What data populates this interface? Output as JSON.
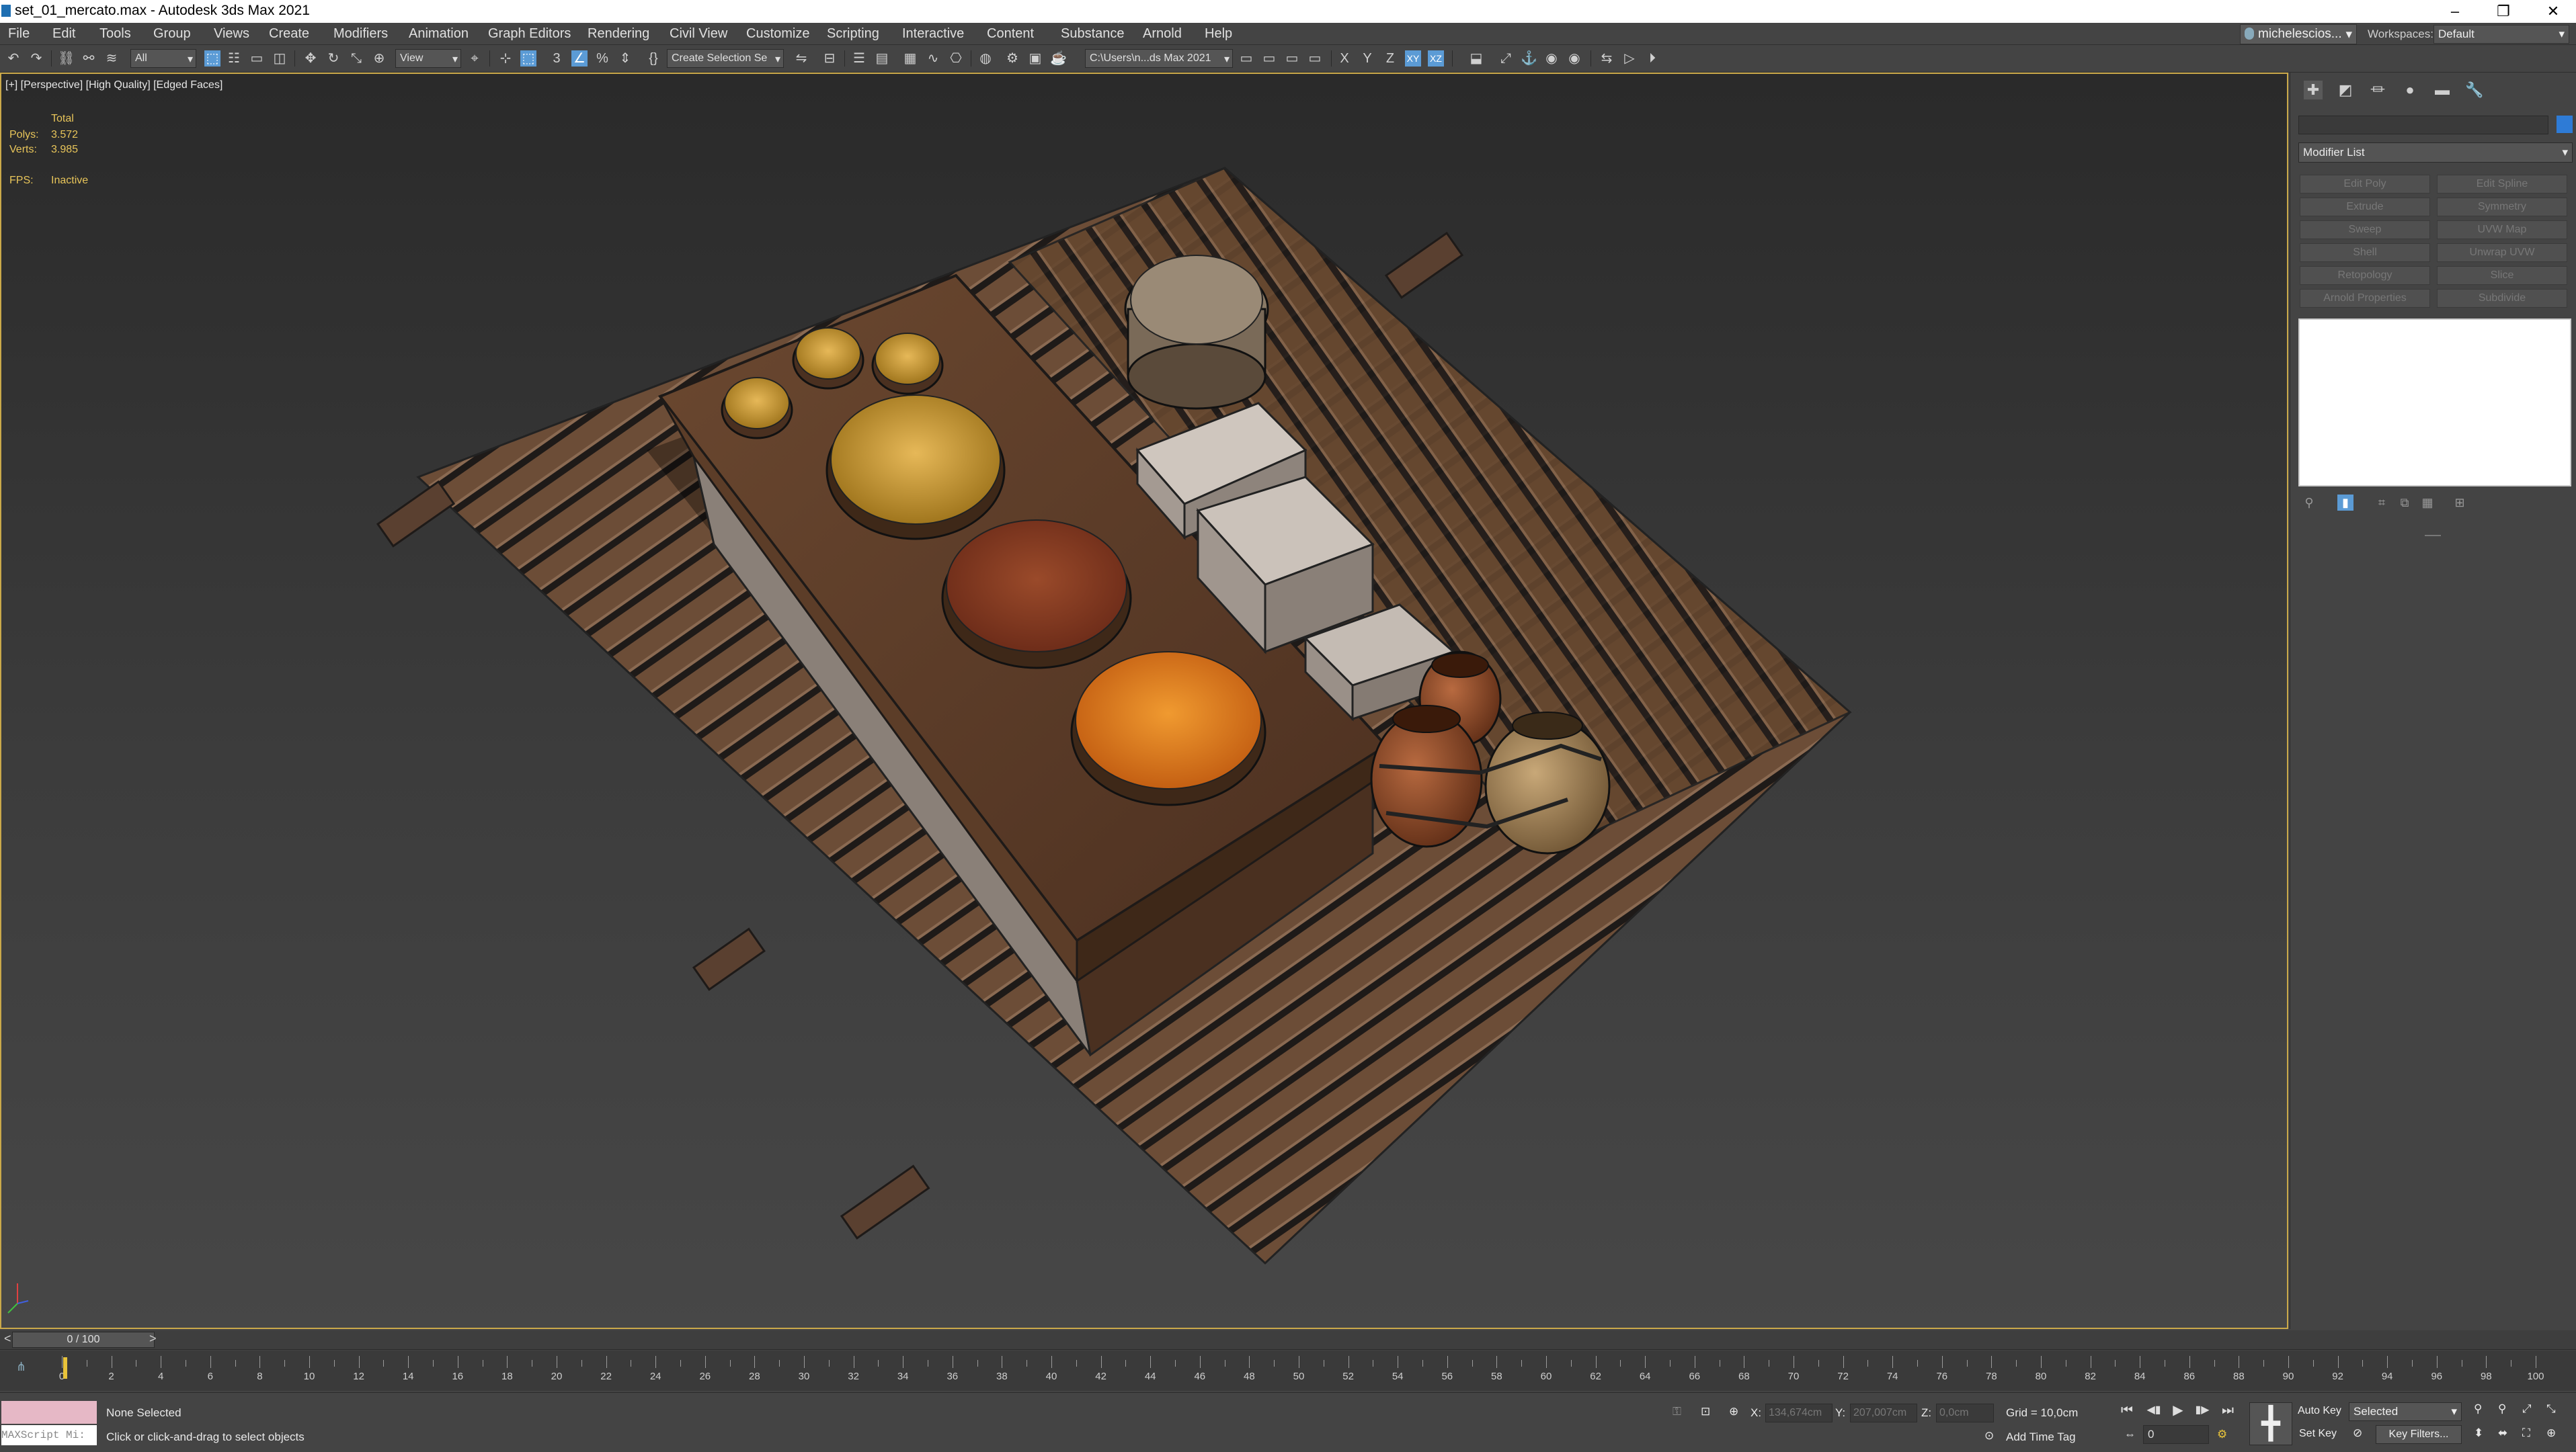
{
  "window": {
    "title": "set_01_mercato.max - Autodesk 3ds Max 2021",
    "minimize_glyph": "–",
    "restore_glyph": "❐",
    "close_glyph": "✕"
  },
  "menu": [
    "File",
    "Edit",
    "Tools",
    "Group",
    "Views",
    "Create",
    "Modifiers",
    "Animation",
    "Graph Editors",
    "Rendering",
    "Civil View",
    "Customize",
    "Scripting",
    "Interactive",
    "Content",
    "Substance",
    "Arnold",
    "Help"
  ],
  "user": {
    "name": "michelescios...",
    "arrow": "▾"
  },
  "workspace": {
    "label": "Workspaces:",
    "value": "Default",
    "arrow": "▾"
  },
  "toolbar": {
    "filter_value": "All",
    "refcoord_value": "View",
    "selection_set_placeholder": "Create Selection Se",
    "project_path": "C:\\Users\\n...ds Max 2021",
    "arrow": "▾",
    "axis_x": "X",
    "axis_y": "Y",
    "axis_z": "Z",
    "axis_xy": "XY",
    "axis_xz": "XZ",
    "icons": {
      "undo": "↶",
      "redo": "↷",
      "link": "⛓",
      "unlink": "⚯",
      "bind": "≋",
      "select": "⬚",
      "select_name": "☷",
      "region": "▭",
      "window": "◫",
      "move": "✥",
      "rotate": "↻",
      "scale": "⤡",
      "place": "⊕",
      "pivot": "⌖",
      "snap": "⊹",
      "snap3": "3",
      "angle_snap": "∠",
      "percent_snap": "%",
      "spinner_snap": "⇕",
      "edit_named": "{}",
      "mirror": "⇋",
      "align": "⊟",
      "toggle_scene": "☰",
      "layer": "▤",
      "ribbon": "▦",
      "curve": "∿",
      "schematic": "⎔",
      "material": "◍",
      "render_setup": "⚙",
      "render_frame": "▣",
      "render": "☕",
      "open_folder": "▭",
      "save": "▭",
      "import": "▭",
      "export": "▭",
      "snapshot": "⬓",
      "orient": "⤢",
      "constraint": "⚓",
      "viewport": "◉",
      "mirror2": "⇆",
      "playblast": "▷",
      "media": "⏵"
    }
  },
  "viewport": {
    "label": "[+] [Perspective] [High Quality] [Edged Faces]",
    "stats_header": "Total",
    "polys_label": "Polys:",
    "polys_value": "3.572",
    "verts_label": "Verts:",
    "verts_value": "3.985",
    "fps_label": "FPS:",
    "fps_value": "Inactive",
    "colors": {
      "border": "#caa94a",
      "stats": "#e8c55a"
    }
  },
  "command_panel": {
    "tabs": [
      "✚",
      "◩",
      "⏛",
      "●",
      "▬",
      "🔧"
    ],
    "modifier_list": "Modifier List",
    "arrow": "▾",
    "buttons": [
      [
        "Edit Poly",
        "Edit Spline"
      ],
      [
        "Extrude",
        "Symmetry"
      ],
      [
        "Sweep",
        "UVW Map"
      ],
      [
        "Shell",
        "Unwrap UVW"
      ],
      [
        "Retopology",
        "Slice"
      ],
      [
        "Arnold Properties",
        "Subdivide"
      ]
    ],
    "stack_icons": [
      "⚲",
      "▮",
      "⌗",
      "⧉",
      "▦",
      "⊞"
    ],
    "object_color": "#2e7bd6"
  },
  "time_slider": {
    "value": "0 / 100",
    "prev": "<",
    "next": ">"
  },
  "track_bar": {
    "labels": [
      "0",
      "2",
      "4",
      "6",
      "8",
      "10",
      "12",
      "14",
      "16",
      "18",
      "20",
      "22",
      "24",
      "26",
      "28",
      "30",
      "32",
      "34",
      "36",
      "38",
      "40",
      "42",
      "44",
      "46",
      "48",
      "50",
      "52",
      "54",
      "56",
      "58",
      "60",
      "62",
      "64",
      "66",
      "68",
      "70",
      "72",
      "74",
      "76",
      "78",
      "80",
      "82",
      "84",
      "86",
      "88",
      "90",
      "92",
      "94",
      "96",
      "98",
      "100"
    ],
    "key_color": "#e8c33a",
    "mini_curve": "⋔"
  },
  "status": {
    "maxscript_placeholder": "MAXScript Mi:",
    "selection": "None Selected",
    "prompt": "Click or click-and-drag to select objects",
    "x_label": "X:",
    "x_value": "134,674cm",
    "y_label": "Y:",
    "y_value": "207,007cm",
    "z_label": "Z:",
    "z_value": "0,0cm",
    "grid": "Grid = 10,0cm",
    "add_time_tag": "Add Time Tag",
    "auto_key": "Auto Key",
    "set_key": "Set Key",
    "selected": "Selected",
    "key_filters": "Key Filters...",
    "frame": "0",
    "set_key_glyph": "╋",
    "playback": [
      "⏮",
      "◀▮",
      "▶",
      "▮▶",
      "⏭"
    ],
    "status_icons": {
      "lock": "⚿",
      "iso": "⊡",
      "abs": "⊕",
      "tag": "⊙",
      "time_cfg": "⚙",
      "key_mode": "⇔",
      "filter_ico": "⊘",
      "nav": [
        "⚲",
        "⚲",
        "⤢",
        "⤡",
        "⬍",
        "⬌",
        "⛶",
        "✥",
        "⊕"
      ]
    }
  }
}
